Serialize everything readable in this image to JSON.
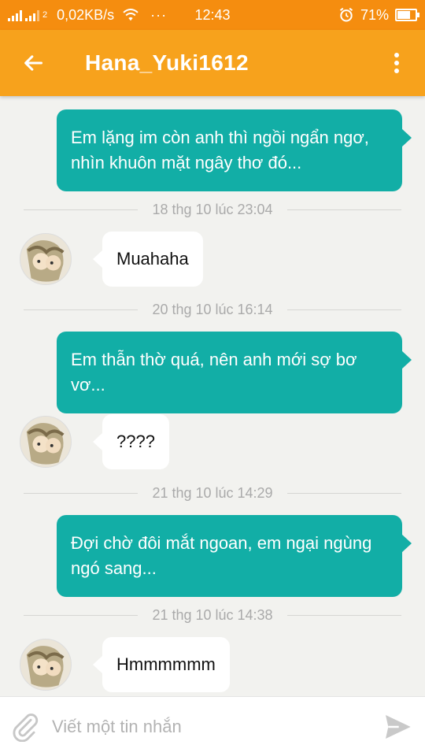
{
  "status_bar": {
    "speed": "0,02KB/s",
    "sim_label": "2",
    "overflow_dots": "···",
    "time": "12:43",
    "battery": "71%",
    "battery_level": 0.71,
    "icons": [
      "signal-icon",
      "wifi-icon",
      "alarm-icon",
      "battery-icon"
    ]
  },
  "header": {
    "title": "Hana_Yuki1612",
    "back_icon": "back-arrow-icon",
    "menu_icon": "more-vert-icon",
    "background": "#f7a21c",
    "status_background": "#f58d0f"
  },
  "messages": {
    "outgoing_color": "#12aea6",
    "items": [
      {
        "type": "outgoing",
        "text": "Em lặng im còn anh thì ngồi ngẩn ngơ, nhìn khuôn mặt ngây thơ đó..."
      },
      {
        "type": "timestamp",
        "text": "18 thg 10 lúc 23:04"
      },
      {
        "type": "incoming",
        "text": "Muahaha"
      },
      {
        "type": "timestamp",
        "text": "20 thg 10 lúc 16:14"
      },
      {
        "type": "outgoing",
        "text": "Em thẫn thờ quá, nên anh mới sợ bơ vơ..."
      },
      {
        "type": "incoming",
        "text": "????"
      },
      {
        "type": "timestamp",
        "text": "21 thg 10 lúc 14:29"
      },
      {
        "type": "outgoing",
        "text": "Đợi chờ đôi mắt ngoan, em ngại ngùng ngó sang..."
      },
      {
        "type": "timestamp",
        "text": "21 thg 10 lúc 14:38"
      },
      {
        "type": "incoming",
        "text": "Hmmmmmm"
      }
    ]
  },
  "composer": {
    "placeholder": "Viết một tin nhắn",
    "value": "",
    "attach_icon": "paperclip-icon",
    "send_icon": "send-icon"
  }
}
